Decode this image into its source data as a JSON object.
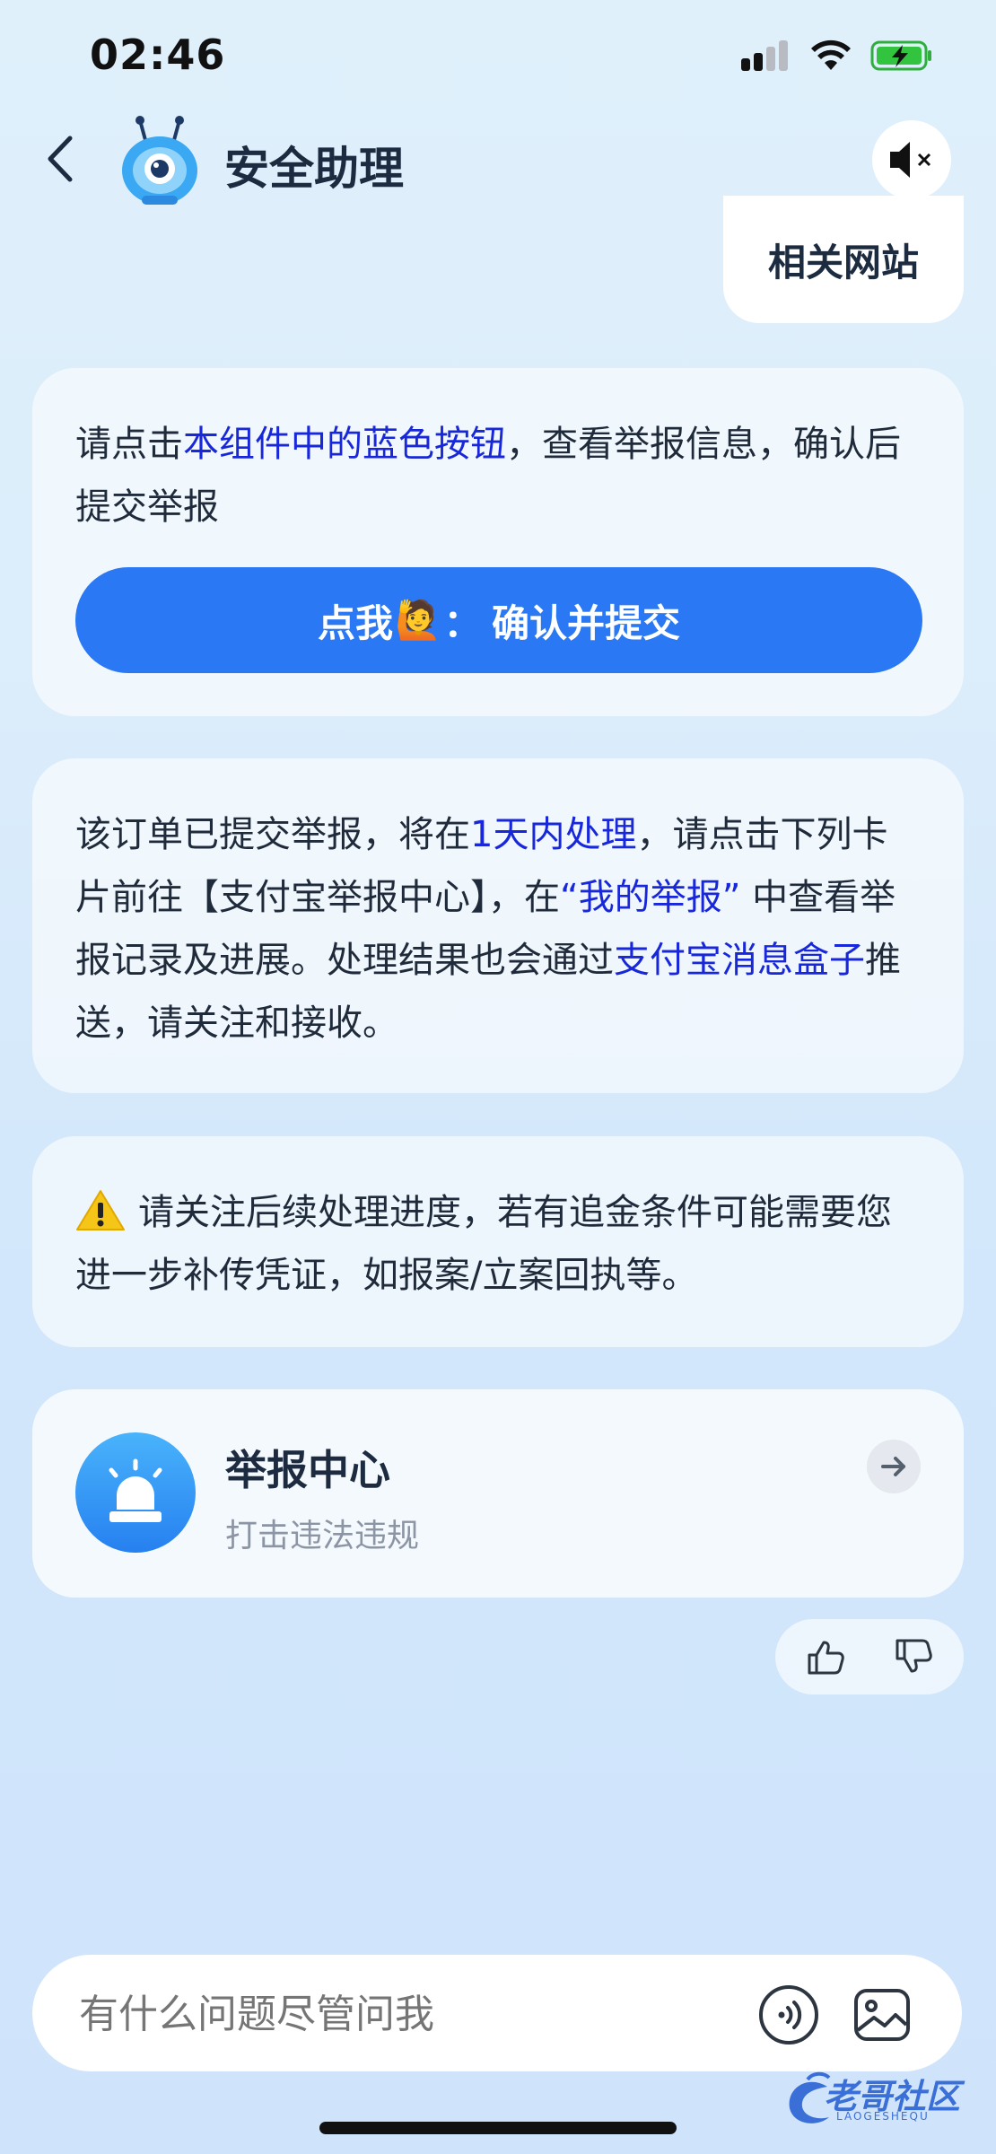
{
  "status_bar": {
    "time": "02:46"
  },
  "header": {
    "title": "安全助理"
  },
  "user_bubble": {
    "text": "相关网站"
  },
  "card1": {
    "text_1": "请点击",
    "text_highlight": "本组件中的蓝色按钮",
    "text_2": "，查看举报信息，确认后提交举报",
    "button_prefix": "点我",
    "button_emoji": "🙋",
    "button_suffix": "：  确认并提交"
  },
  "card2": {
    "text_1": "该订单已提交举报，将在",
    "hl_1": "1天内处理",
    "text_2": "，请点击下列卡片前往【支付宝举报中心】，在",
    "hl_2": "“我的举报”",
    "text_3": " 中查看举报记录及进展。处理结果也会通过",
    "hl_3": "支付宝消息盒子",
    "text_4": "推送，请关注和接收。"
  },
  "card3": {
    "text": "请关注后续处理进度，若有追金条件可能需要您进一步补传凭证，如报案/立案回执等。"
  },
  "report_center": {
    "title": "举报中心",
    "subtitle": "打击违法违规"
  },
  "input": {
    "placeholder": "有什么问题尽管问我"
  },
  "watermark": {
    "text": "老哥社区",
    "sub": "LAOGESHEQU"
  },
  "colors": {
    "accent": "#2a78f4",
    "highlight_text": "#1727d9"
  }
}
